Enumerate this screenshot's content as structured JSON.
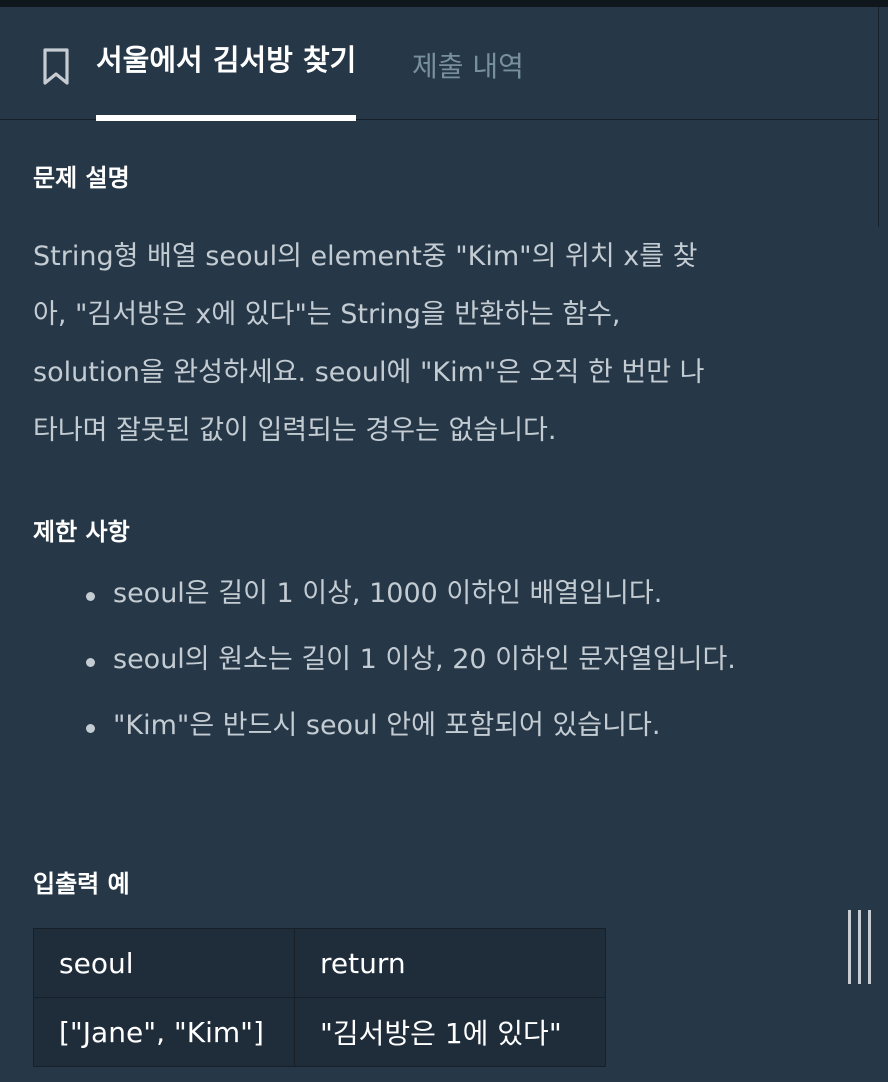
{
  "tabs": {
    "bookmark_icon": "bookmark-icon",
    "active_label": "서울에서 김서방 찾기",
    "inactive_label": "제출 내역"
  },
  "sections": {
    "description_title": "문제 설명",
    "description_lines": [
      "String형 배열 seoul의 element중 \"Kim\"의 위치 x를 찾",
      "아, \"김서방은 x에 있다\"는 String을 반환하는 함수,",
      "solution을 완성하세요. seoul에 \"Kim\"은 오직 한 번만 나",
      "타나며 잘못된 값이 입력되는 경우는 없습니다."
    ],
    "limits_title": "제한 사항",
    "limits": [
      "seoul은 길이 1 이상, 1000 이하인 배열입니다.",
      "seoul의 원소는 길이 1 이상, 20 이하인 문자열입니다.",
      "\"Kim\"은 반드시 seoul 안에 포함되어 있습니다."
    ],
    "io_title": "입출력 예"
  },
  "io_table": {
    "headers": [
      "seoul",
      "return"
    ],
    "rows": [
      [
        "[\"Jane\", \"Kim\"]",
        "\"김서방은 1에 있다\""
      ]
    ]
  },
  "colors": {
    "background": "#263747",
    "tab_active": "#ffffff",
    "tab_inactive": "#78909c",
    "table_bg": "#1f2d3b"
  }
}
